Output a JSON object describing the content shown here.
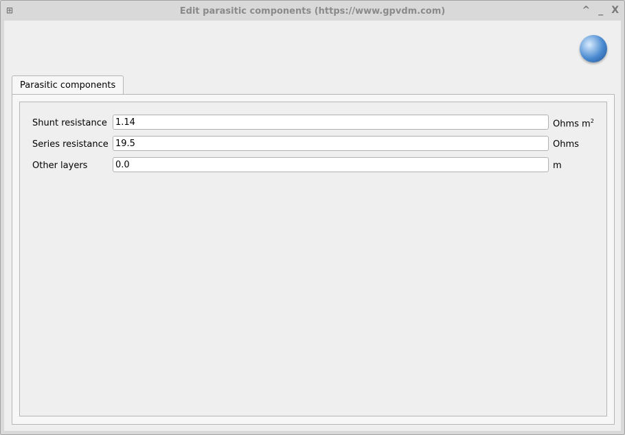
{
  "window": {
    "title": "Edit parasitic components  (https://www.gpvdm.com)"
  },
  "tab": {
    "label": "Parasitic components"
  },
  "fields": [
    {
      "label": "Shunt resistance",
      "value": "1.14",
      "unit": "Ohms m",
      "unit_sup": "2"
    },
    {
      "label": "Series resistance",
      "value": "19.5",
      "unit": "Ohms",
      "unit_sup": ""
    },
    {
      "label": "Other layers",
      "value": "0.0",
      "unit": "m",
      "unit_sup": ""
    }
  ]
}
